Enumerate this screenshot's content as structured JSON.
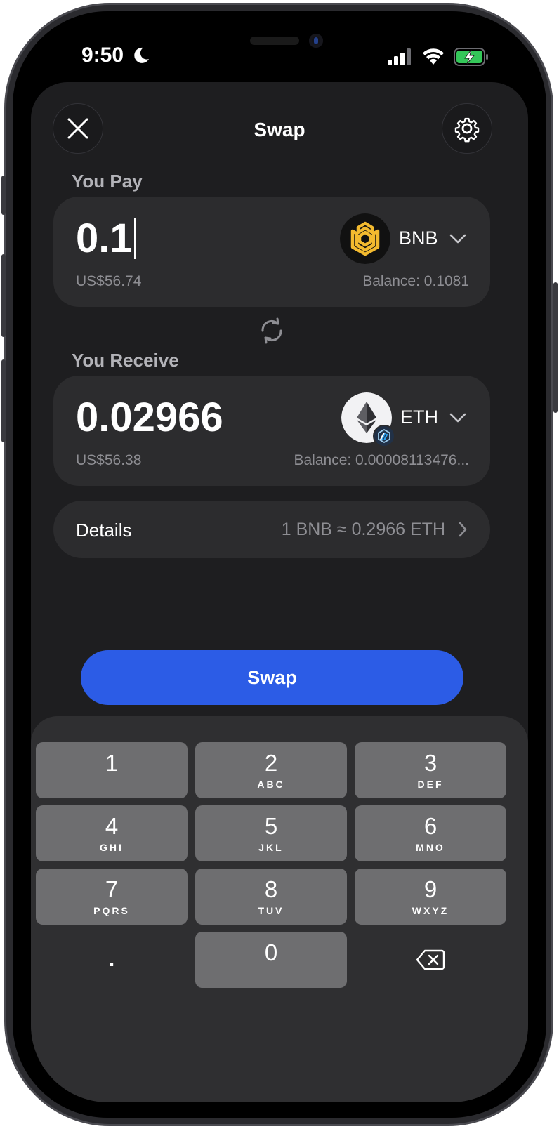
{
  "status_bar": {
    "time": "9:50"
  },
  "header": {
    "title": "Swap"
  },
  "pay": {
    "label": "You Pay",
    "amount": "0.1",
    "usd": "US$56.74",
    "token": "BNB",
    "balance": "Balance: 0.1081"
  },
  "receive": {
    "label": "You Receive",
    "amount": "0.02966",
    "usd": "US$56.38",
    "token": "ETH",
    "balance": "Balance: 0.00008113476..."
  },
  "details": {
    "label": "Details",
    "rate": "1 BNB ≈ 0.2966 ETH"
  },
  "swap_button": {
    "label": "Swap"
  },
  "keypad": {
    "keys": [
      {
        "digit": "1",
        "letters": ""
      },
      {
        "digit": "2",
        "letters": "ABC"
      },
      {
        "digit": "3",
        "letters": "DEF"
      },
      {
        "digit": "4",
        "letters": "GHI"
      },
      {
        "digit": "5",
        "letters": "JKL"
      },
      {
        "digit": "6",
        "letters": "MNO"
      },
      {
        "digit": "7",
        "letters": "PQRS"
      },
      {
        "digit": "8",
        "letters": "TUV"
      },
      {
        "digit": "9",
        "letters": "WXYZ"
      },
      {
        "digit": "0",
        "letters": ""
      }
    ],
    "decimal": "."
  },
  "colors": {
    "accent": "#2c5ce6",
    "bnb": "#f3ba2f",
    "battery": "#34c759"
  },
  "icons": [
    "close-icon",
    "gear-icon",
    "swap-arrows-icon",
    "chevron-down-icon",
    "chevron-right-icon",
    "backspace-icon",
    "moon-icon",
    "signal-icon",
    "wifi-icon",
    "battery-charging-icon",
    "bnb-logo-icon",
    "eth-logo-icon",
    "arbitrum-badge-icon"
  ]
}
